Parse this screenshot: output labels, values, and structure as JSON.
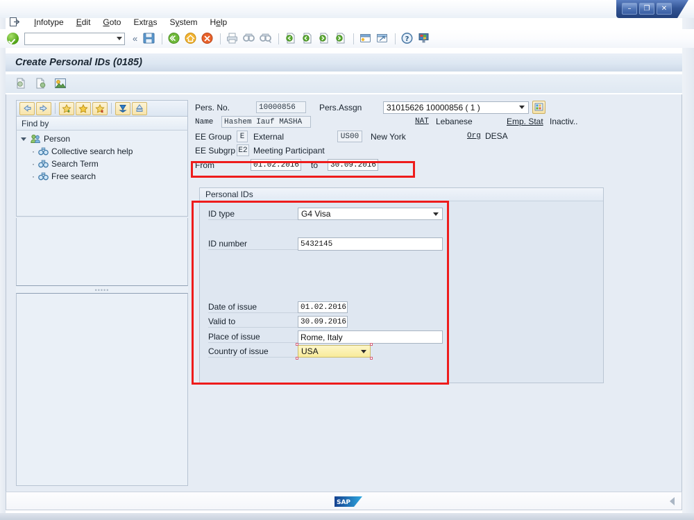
{
  "window": {
    "buttons": [
      {
        "name": "minimize-button",
        "glyph": "–"
      },
      {
        "name": "restore-button",
        "glyph": "❐"
      },
      {
        "name": "close-button",
        "glyph": "✕"
      }
    ]
  },
  "menubar": {
    "system_icon": "exit-door-icon",
    "items": [
      {
        "label": "Infotype",
        "accel": "I"
      },
      {
        "label": "Edit",
        "accel": "E"
      },
      {
        "label": "Goto",
        "accel": "G"
      },
      {
        "label": "Extras",
        "accel": "a"
      },
      {
        "label": "System",
        "accel": "y"
      },
      {
        "label": "Help",
        "accel": "e"
      }
    ]
  },
  "toolbar": {
    "ok_button": "enter-check-icon",
    "command_field_value": "",
    "command_field_placeholder": "",
    "dropdown_icon": "chevron-down-icon",
    "collapse_icon": "«",
    "icons": [
      "save-icon",
      "back-green-icon",
      "exit-yellow-icon",
      "cancel-red-icon",
      "print-icon",
      "find-icon",
      "find-next-icon",
      "first-page-icon",
      "previous-page-icon",
      "next-page-icon",
      "last-page-icon",
      "create-session-icon",
      "create-shortcut-icon",
      "help-icon",
      "customize-layout-icon"
    ]
  },
  "title": {
    "text": "Create Personal IDs (0185)"
  },
  "fnbar": {
    "icons": [
      "copy-infotype-icon",
      "insert-infotype-icon",
      "person-details-icon"
    ]
  },
  "sidebar": {
    "toolbar_buttons": [
      "back-arrow-icon",
      "forward-arrow-icon",
      "add-favorite-icon",
      "favorite-star-icon",
      "remove-favorite-icon",
      "download-icon",
      "upload-icon"
    ],
    "header": "Find by",
    "tree": {
      "root": {
        "label": "Person",
        "icon": "persons-icon",
        "expanded": true
      },
      "children": [
        {
          "label": "Collective search help",
          "icon": "binoculars-icon"
        },
        {
          "label": "Search Term",
          "icon": "binoculars-icon"
        },
        {
          "label": "Free search",
          "icon": "binoculars-icon"
        }
      ]
    }
  },
  "header_fields": {
    "pers_no_label": "Pers. No.",
    "pers_no_value": "10000856",
    "pers_assgn_label": "Pers.Assgn",
    "pers_assgn_value": "31015626 10000856 ( 1 )",
    "match_button_icon": "multiple-selection-icon",
    "name_label": "Name",
    "name_value": "Hashem Iauf MASHA",
    "nat_label": "NAT",
    "nat_value": "Lebanese",
    "emp_stat_label": "Emp. Stat",
    "emp_stat_value": "Inactiv..",
    "ee_group_label": "EE Group",
    "ee_group_key": "E",
    "ee_group_text": "External",
    "pers_area_key": "US00",
    "pers_area_text": "New York",
    "org_label": "Org",
    "org_value": "DESA",
    "ee_subgrp_label": "EE Subgrp",
    "ee_subgrp_key": "E2",
    "ee_subgrp_text": "Meeting Participant",
    "from_label": "From",
    "from_value": "01.02.2016",
    "to_label": "to",
    "to_value": "30.09.2016"
  },
  "personal_ids": {
    "group_title": "Personal IDs",
    "id_type_label": "ID type",
    "id_type_value": "G4 Visa",
    "id_number_label": "ID number",
    "id_number_value": "5432145",
    "date_of_issue_label": "Date of issue",
    "date_of_issue_value": "01.02.2016",
    "valid_to_label": "Valid to",
    "valid_to_value": "30.09.2016",
    "place_of_issue_label": "Place of issue",
    "place_of_issue_value": "Rome, Italy",
    "country_of_issue_label": "Country of issue",
    "country_of_issue_value": "USA"
  },
  "annotations": {
    "highlight_color": "#ee1c1c",
    "boxes": [
      {
        "name": "validity-period-highlight"
      },
      {
        "name": "personal-ids-fields-highlight"
      }
    ]
  },
  "statusbar": {
    "logo": "sap-logo",
    "resize_icon": "resize-grip-icon"
  }
}
